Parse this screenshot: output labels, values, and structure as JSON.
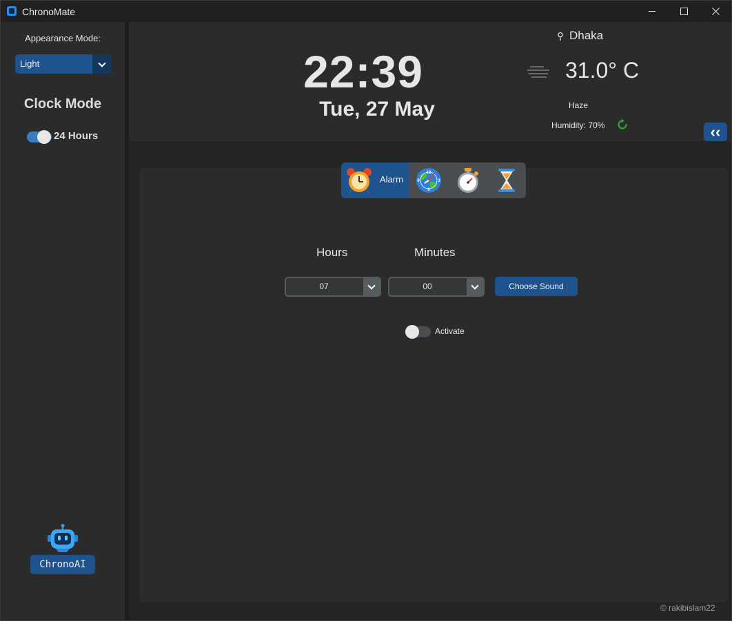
{
  "window": {
    "title": "ChronoMate"
  },
  "sidebar": {
    "appearance_label": "Appearance Mode:",
    "appearance_value": "Light",
    "clock_mode_title": "Clock Mode",
    "hours_toggle_label": "24 Hours",
    "hours_toggle_on": true,
    "ai_button_label": "ChronoAI"
  },
  "header": {
    "time": "22:39",
    "date": "Tue, 27 May",
    "weather": {
      "city": "Dhaka",
      "temperature": "31.0° C",
      "condition": "Haze",
      "humidity": "Humidity: 70%"
    },
    "collapse_label": "‹‹"
  },
  "tabs": {
    "items": [
      {
        "label": "Alarm",
        "icon": "alarm-clock-icon",
        "selected": true
      },
      {
        "label": "",
        "icon": "world-clock-icon",
        "selected": false
      },
      {
        "label": "",
        "icon": "stopwatch-icon",
        "selected": false
      },
      {
        "label": "",
        "icon": "hourglass-icon",
        "selected": false
      }
    ]
  },
  "alarm": {
    "hours_label": "Hours",
    "minutes_label": "Minutes",
    "hours_value": "07",
    "minutes_value": "00",
    "choose_sound_label": "Choose Sound",
    "activate_label": "Activate",
    "activate_on": false
  },
  "footer": {
    "credit": "© rakibislam22"
  },
  "colors": {
    "accent": "#1f538d",
    "accent_dark": "#14375e",
    "toggle_on": "#3a7ebf",
    "background": "#242424",
    "panel": "#2b2b2b",
    "refresh": "#2fa82f"
  }
}
